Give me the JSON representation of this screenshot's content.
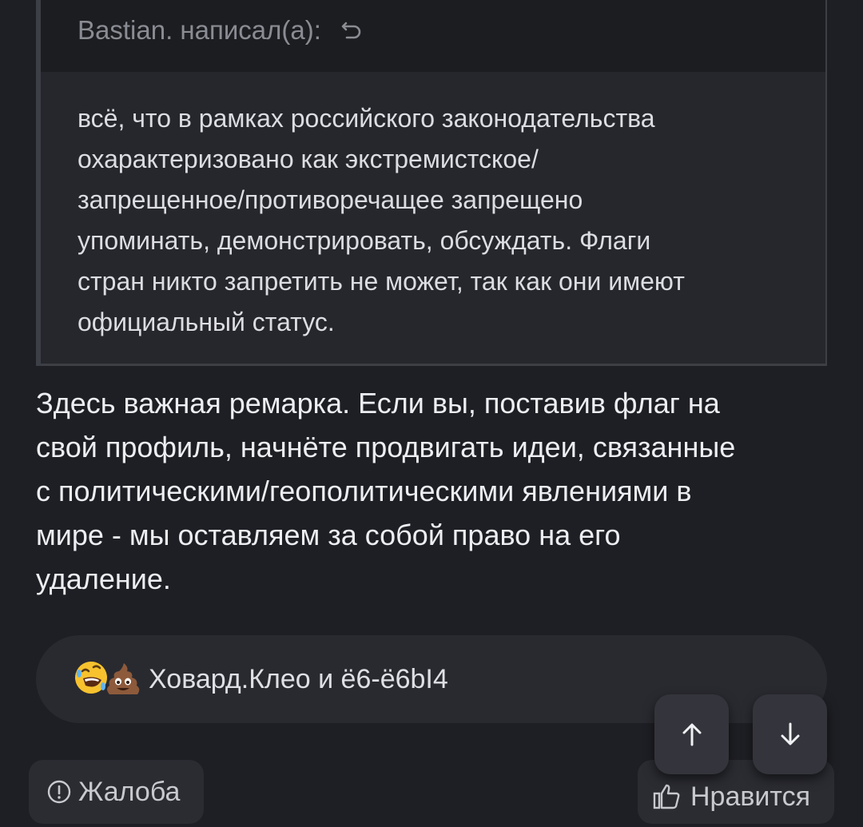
{
  "quote": {
    "author": "Bastian. написал(а):",
    "text": "всё, что в рамках российского законодательства\nохарактеризовано как экстремистское/\nзапрещенное/противоречащее запрещено\nупоминать, демонстрировать, обсуждать. Флаги\nстран никто запретить не может, так как они имеют\nофициальный статус."
  },
  "post": {
    "text": "Здесь важная ремарка. Если вы, поставив флаг на\nсвой профиль, начнёте продвигать идеи, связанные\nс политическими/геополитическими явлениями в\nмире - мы оставляем за собой право на его\nудаление."
  },
  "reactions": {
    "emojis": [
      "rolling-on-floor-laughing-emoji",
      "pile-of-poo-emoji"
    ],
    "users": "Ховард.Клео и ё6-ё6bI4"
  },
  "actions": {
    "report_label": "Жалоба",
    "like_label": "Нравится"
  },
  "navigation": {
    "up_icon": "arrow-up-icon",
    "down_icon": "arrow-down-icon"
  },
  "colors": {
    "background": "#1e1f24",
    "quote_background": "#26272c",
    "button_background": "#2b2c32"
  }
}
